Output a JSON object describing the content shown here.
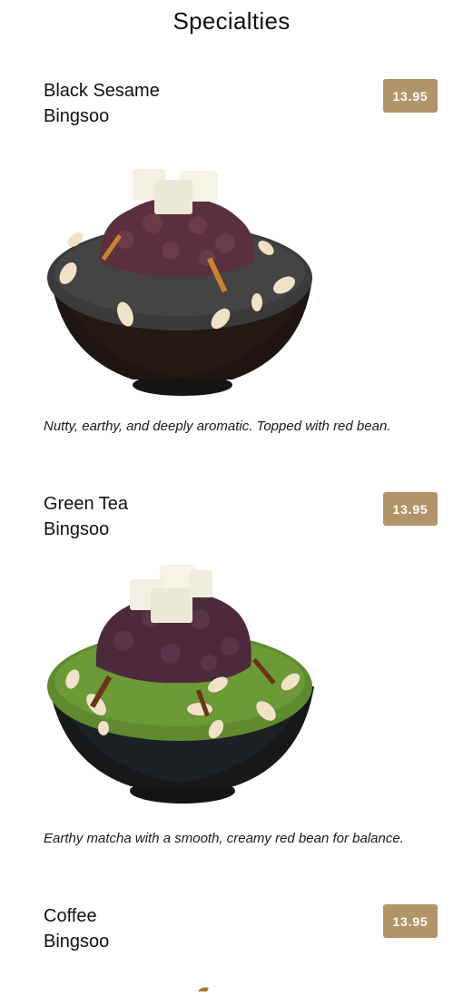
{
  "page": {
    "title": "Specialties"
  },
  "items": [
    {
      "name_line1": "Black Sesame",
      "name_line2": "Bingsoo",
      "price": "13.95",
      "description": "Nutty, earthy, and deeply aromatic. Topped with red bean.",
      "image_icon": "black-sesame-bingsoo-image",
      "topping_color": "#3a3a3a"
    },
    {
      "name_line1": "Green Tea",
      "name_line2": "Bingsoo",
      "price": "13.95",
      "description": "Earthy matcha with a smooth, creamy red bean for balance.",
      "image_icon": "green-tea-bingsoo-image",
      "topping_color": "#5f8a2e"
    },
    {
      "name_line1": "Coffee",
      "name_line2": "Bingsoo",
      "price": "13.95"
    }
  ],
  "colors": {
    "price_badge": "#b39468",
    "text": "#111111",
    "background": "#ffffff"
  }
}
